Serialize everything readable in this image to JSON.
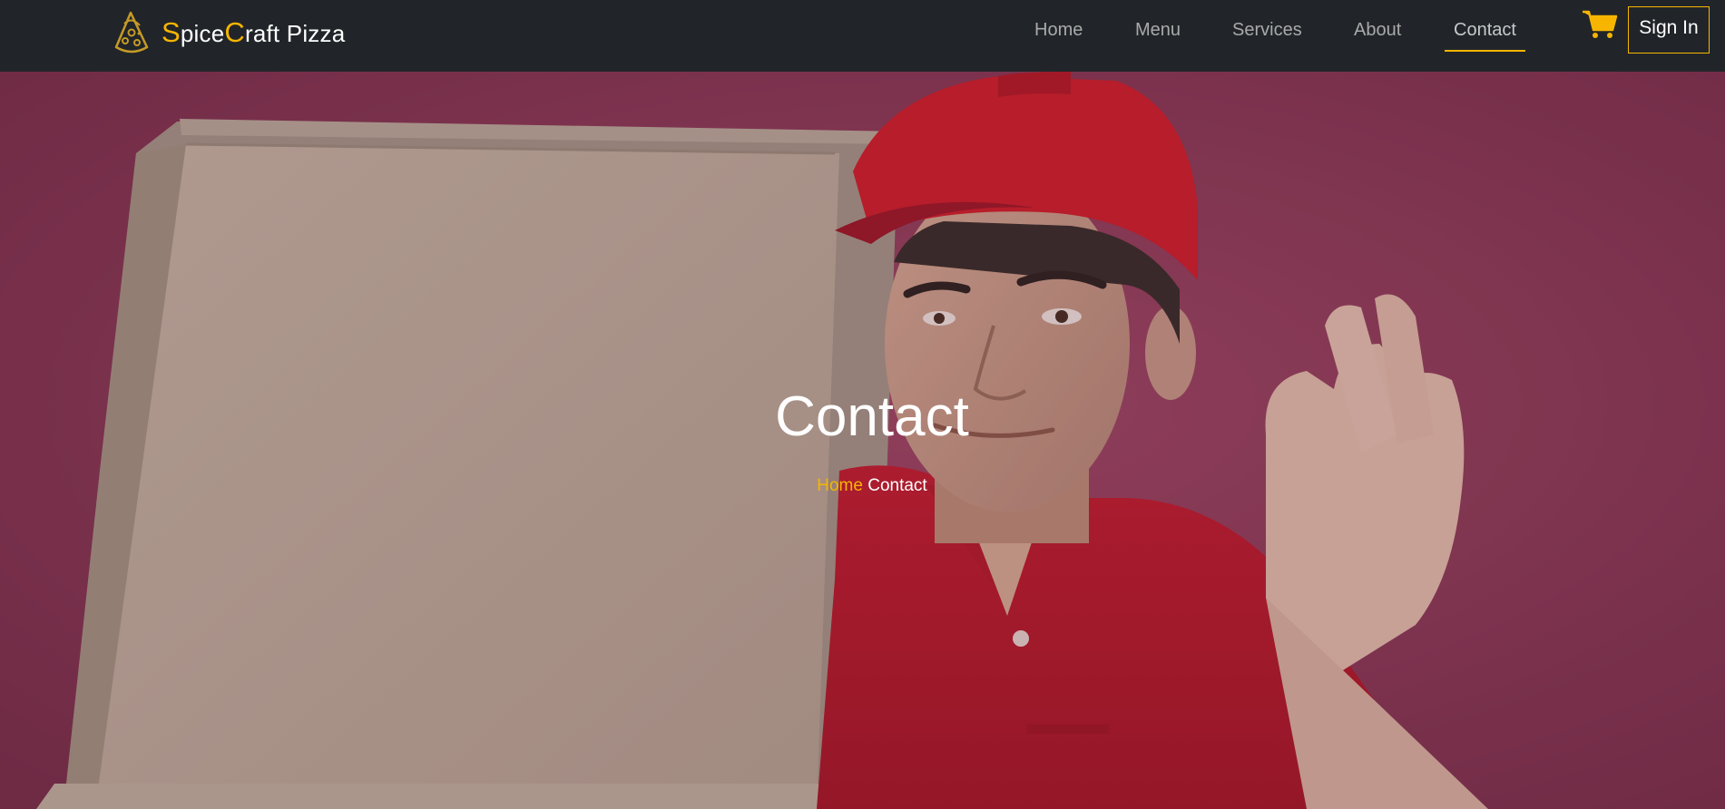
{
  "brand": {
    "first_cap": "S",
    "first_rest": "pice",
    "second_cap": "C",
    "second_rest": "raft Pizza"
  },
  "nav": {
    "items": [
      {
        "label": "Home",
        "active": false
      },
      {
        "label": "Menu",
        "active": false
      },
      {
        "label": "Services",
        "active": false
      },
      {
        "label": "About",
        "active": false
      },
      {
        "label": "Contact",
        "active": true
      }
    ],
    "signin_label": "Sign In"
  },
  "hero": {
    "title": "Contact",
    "breadcrumb": {
      "home": "Home",
      "current": "Contact"
    }
  },
  "colors": {
    "navbar_bg": "#212529",
    "accent": "#f7b500",
    "hero_bg": "#8e3d5a"
  },
  "icons": {
    "logo": "pizza-slice-icon",
    "cart": "shopping-cart-icon"
  }
}
